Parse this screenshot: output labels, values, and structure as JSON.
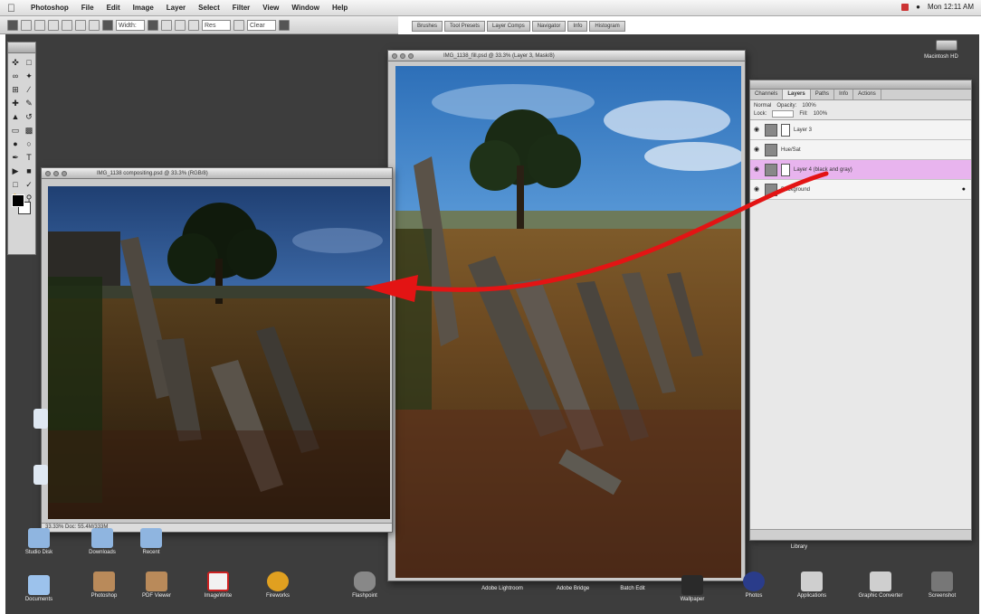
{
  "menubar": {
    "apple": "",
    "items": [
      "Photoshop",
      "File",
      "Edit",
      "Image",
      "Layer",
      "Select",
      "Filter",
      "View",
      "Window",
      "Help"
    ],
    "right": "Mon 12:11 AM"
  },
  "optionsbar": {
    "field1": "Width:",
    "field2": "Res",
    "field3": "Clear"
  },
  "panel_well": [
    "Brushes",
    "Tool Presets",
    "Layer Comps",
    "Navigator",
    "Info",
    "Histogram"
  ],
  "left_window": {
    "title": "IMG_1138 compositing.psd @ 33.3% (RGB/8)",
    "status": "33.33%  Doc: 55.4M/333M"
  },
  "center_window": {
    "title": "IMG_1138_fill.psd @ 33.3% (Layer 3, Mask/8)"
  },
  "layers_panel": {
    "tabs": [
      "Channels",
      "Layers",
      "Paths",
      "Info",
      "Actions"
    ],
    "blend": "Normal",
    "opacity_label": "Opacity:",
    "opacity": "100%",
    "lock_label": "Lock:",
    "fill_label": "Fill:",
    "fill": "100%",
    "layers": [
      {
        "name": "Layer 3",
        "selected": false
      },
      {
        "name": "Hue/Sat",
        "selected": false
      },
      {
        "name": "Layer 4 (black and gray)",
        "selected": true
      },
      {
        "name": "Background",
        "selected": false
      }
    ]
  },
  "hd": {
    "label": "Macintosh HD"
  },
  "desktop_icons": [
    {
      "label": "Studio Disk"
    },
    {
      "label": "Downloads"
    },
    {
      "label": "Recent"
    },
    {
      "label": "Documents"
    },
    {
      "label": "Photoshop"
    },
    {
      "label": "PDF Viewer"
    },
    {
      "label": "ImageWrite"
    },
    {
      "label": "Fireworks"
    },
    {
      "label": "Flashpoint"
    },
    {
      "label": "Adobe Lightroom"
    },
    {
      "label": "Adobe Bridge"
    },
    {
      "label": "Batch Edit"
    },
    {
      "label": "Wallpaper"
    },
    {
      "label": "Photos"
    },
    {
      "label": "Applications"
    },
    {
      "label": "Graphic Converter"
    },
    {
      "label": "Library"
    },
    {
      "label": "Screenshot"
    }
  ],
  "colors": {
    "desktop": "#3d3d3d",
    "arrow": "#e31414",
    "selected_layer": "#e8b4ee"
  }
}
